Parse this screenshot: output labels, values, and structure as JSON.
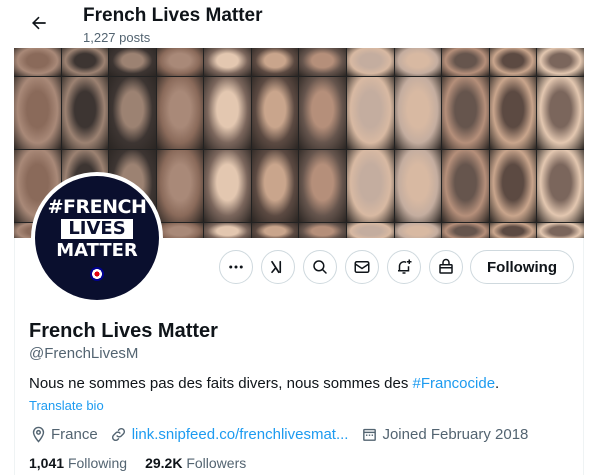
{
  "header": {
    "title": "French Lives Matter",
    "posts": "1,227 posts"
  },
  "avatar": {
    "line1": "#FRENCH",
    "line2": "LIVES",
    "line3": "MATTER"
  },
  "actions": {
    "follow_label": "Following",
    "icons": [
      "more-icon",
      "grok-icon",
      "search-icon",
      "message-icon",
      "notify-icon",
      "subscribe-icon"
    ]
  },
  "profile": {
    "name": "French Lives Matter",
    "handle": "@FrenchLivesM",
    "bio_text": "Nous ne sommes pas des faits divers, nous sommes des ",
    "bio_hashtag": "#Francocide",
    "bio_end": ".",
    "translate": "Translate bio",
    "location": "France",
    "link": "link.snipfeed.co/frenchlivesmat...",
    "joined": "Joined February 2018"
  },
  "stats": {
    "following_count": "1,041",
    "following_label": "Following",
    "followers_count": "29.2K",
    "followers_label": "Followers"
  },
  "colors": {
    "accent": "#1d9bf0",
    "secondary_text": "#536471",
    "border": "#cfd9de"
  }
}
